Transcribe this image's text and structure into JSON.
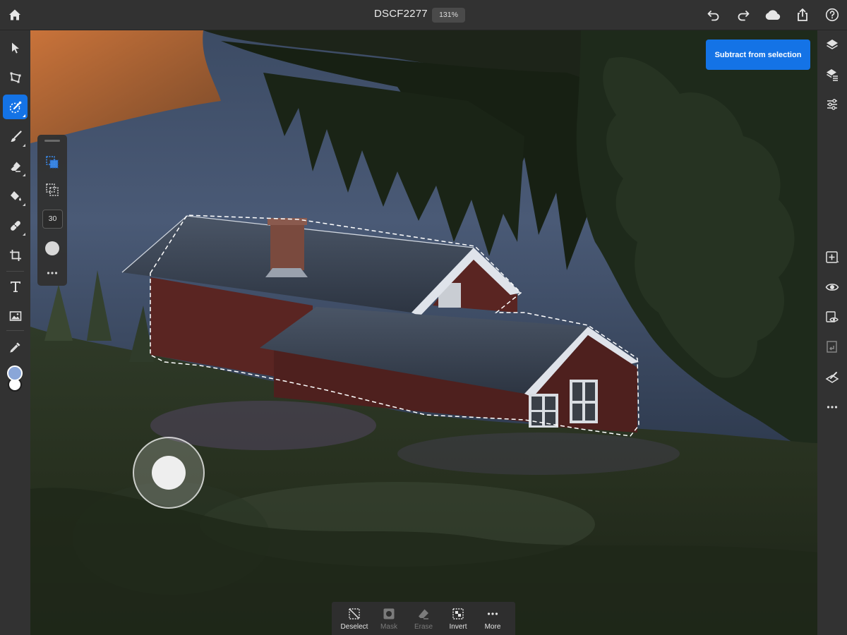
{
  "app": {
    "document_title": "DSCF2277",
    "zoom_level": "131%"
  },
  "topbar": {
    "icons": [
      "home-icon",
      "undo-icon",
      "redo-icon",
      "cloud-icon",
      "share-icon",
      "help-icon"
    ]
  },
  "left_toolbar": {
    "tools": [
      "move-tool",
      "transform-tool",
      "quick-select-tool",
      "brush-tool",
      "eraser-tool",
      "fill-tool",
      "healing-tool",
      "crop-tool",
      "type-tool",
      "place-image-tool",
      "eyedropper-tool"
    ],
    "active_tool": "quick-select-tool",
    "foreground_color": "#8aa6d8",
    "background_color": "#ffffff"
  },
  "tool_options": {
    "brush_size": "30",
    "icons": [
      "add-to-selection-icon",
      "subtract-from-selection-icon",
      "brush-hardness-icon",
      "more-options-icon"
    ]
  },
  "right_toolbar": {
    "icons": [
      "layers-icon",
      "layer-properties-icon",
      "adjustments-icon",
      "add-layer-icon",
      "visibility-icon",
      "mask-visibility-icon",
      "clipping-icon",
      "layer-effects-icon",
      "more-icon"
    ]
  },
  "selection_hint": {
    "button_label": "Subtract from selection"
  },
  "bottom_bar": {
    "items": [
      {
        "label": "Deselect",
        "icon": "deselect-icon",
        "enabled": true
      },
      {
        "label": "Mask",
        "icon": "mask-icon",
        "enabled": false
      },
      {
        "label": "Erase",
        "icon": "erase-icon",
        "enabled": false
      },
      {
        "label": "Invert",
        "icon": "invert-icon",
        "enabled": true
      },
      {
        "label": "More",
        "icon": "more-icon",
        "enabled": true
      }
    ]
  },
  "colors": {
    "accent": "#1473e6",
    "toolbar": "#323232"
  }
}
